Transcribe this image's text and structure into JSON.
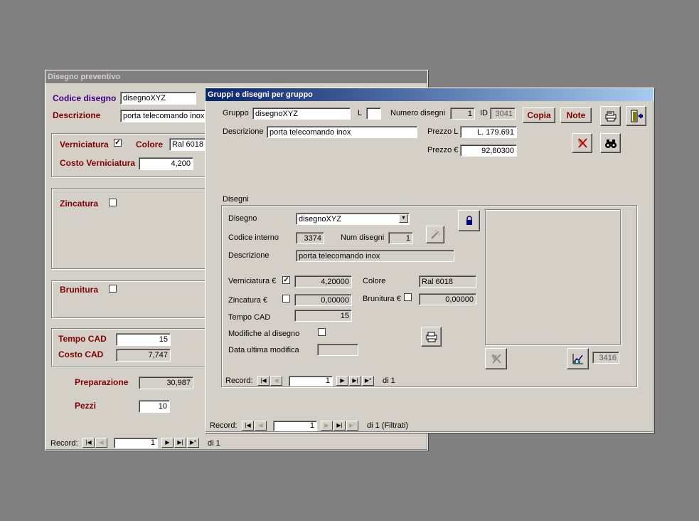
{
  "back_window": {
    "title": "Disegno preventivo",
    "codice_label": "Codice disegno",
    "codice_value": "disegnoXYZ",
    "descrizione_label": "Descrizione",
    "descrizione_value": "porta telecomando inox",
    "verniciatura_label": "Verniciatura",
    "verniciatura_checked": "✓",
    "colore_label": "Colore",
    "colore_value": "Ral 6018",
    "costo_vern_label": "Costo Verniciatura",
    "costo_vern_value": "4,200",
    "zincatura_label": "Zincatura",
    "brunitura_label": "Brunitura",
    "tempo_cad_label": "Tempo CAD",
    "tempo_cad_value": "15",
    "costo_cad_label": "Costo CAD",
    "costo_cad_value": "7,747",
    "preparazione_label": "Preparazione",
    "preparazione_value": "30,987",
    "pezzi_label": "Pezzi",
    "pezzi_value": "10",
    "record_label": "Record:",
    "record_value": "1",
    "record_of": "di 1"
  },
  "front_window": {
    "title": "Gruppi e disegni per gruppo",
    "gruppo_label": "Gruppo",
    "gruppo_value": "disegnoXYZ",
    "l_label": "L",
    "l_value": "",
    "num_disegni_label": "Numero disegni",
    "num_disegni_value": "1",
    "id_label": "ID",
    "id_value": "3041",
    "copia_label": "Copia",
    "note_label": "Note",
    "descrizione_label": "Descrizione",
    "descrizione_value": "porta telecomando inox",
    "prezzo_l_label": "Prezzo L",
    "prezzo_l_value": "L. 179.691",
    "prezzo_e_label": "Prezzo €",
    "prezzo_e_value": "92,80300",
    "record_label": "Record:",
    "record_value": "1",
    "record_of": "di 1 (Filtrati)"
  },
  "subform": {
    "section_label": "Disegni",
    "disegno_label": "Disegno",
    "disegno_value": "disegnoXYZ",
    "codice_interno_label": "Codice interno",
    "codice_interno_value": "3374",
    "num_disegni_label": "Num disegni",
    "num_disegni_value": "1",
    "descrizione_label": "Descrizione",
    "descrizione_value": "porta telecomando inox",
    "verniciatura_label": "Verniciatura €",
    "verniciatura_checked": "✓",
    "verniciatura_value": "4,20000",
    "colore_label": "Colore",
    "colore_value": "Ral 6018",
    "zincatura_label": "Zincatura €",
    "zincatura_value": "0,00000",
    "brunitura_label": "Brunitura €",
    "brunitura_value": "0,00000",
    "tempo_cad_label": "Tempo CAD",
    "tempo_cad_value": "15",
    "modifiche_label": "Modifiche al disegno",
    "data_modifica_label": "Data ultima modifica",
    "data_modifica_value": "",
    "image_id_value": "3416",
    "record_label": "Record:",
    "record_value": "1",
    "record_of": "di 1"
  },
  "colors": {
    "desktop": "#808080",
    "window_face": "#d4d0c8",
    "label_maroon": "#800000",
    "label_purple": "#400080",
    "title_active_start": "#0a246a",
    "title_active_end": "#a6caf0"
  },
  "icons": [
    "lock-icon",
    "magic-wand-icon",
    "printer-icon",
    "exit-door-icon",
    "delete-icon",
    "binoculars-icon",
    "chart-icon",
    "disabled-delete-icon"
  ]
}
